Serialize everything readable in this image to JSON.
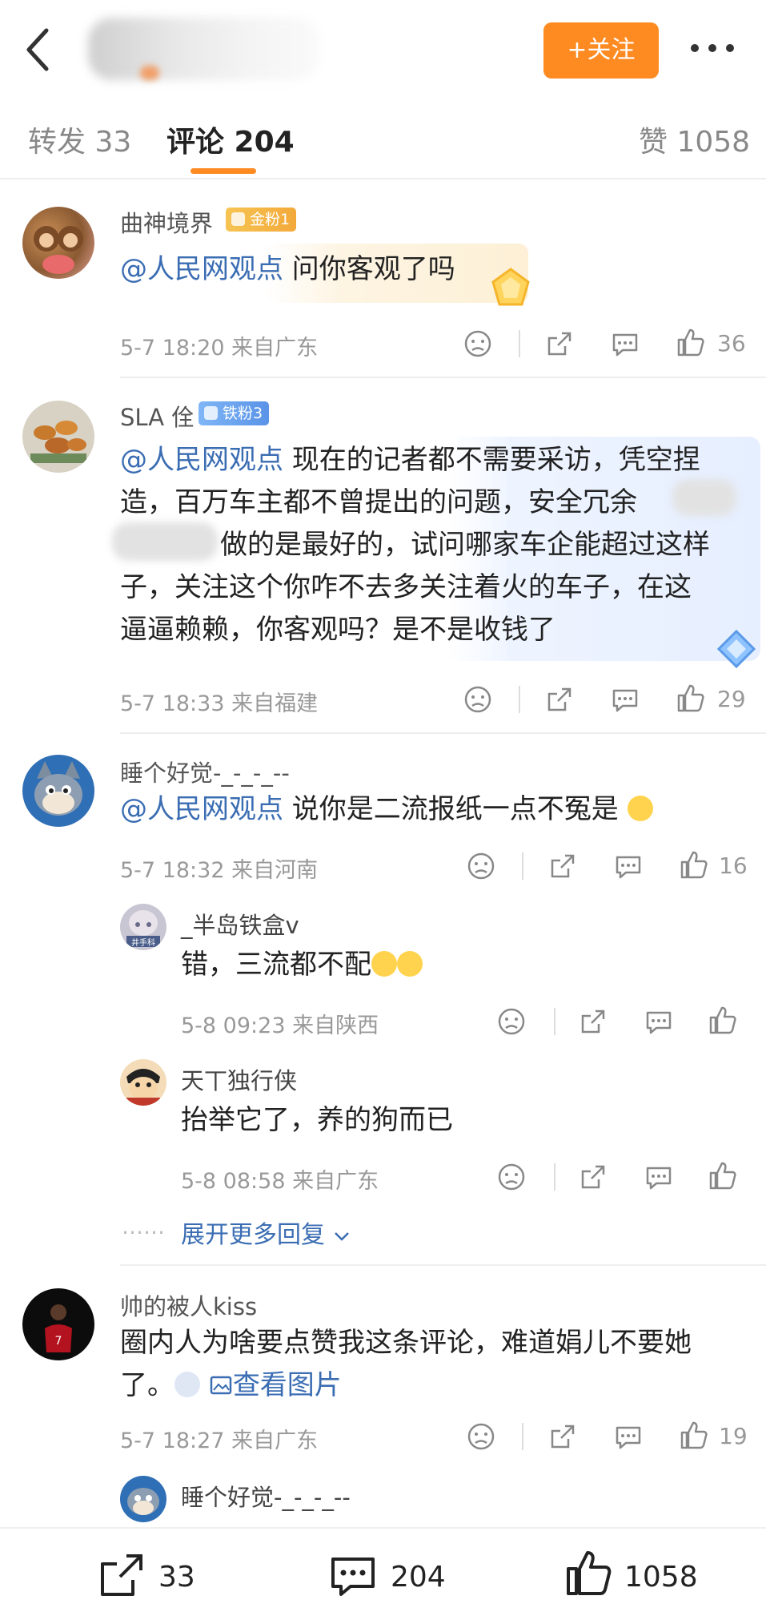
{
  "header": {
    "follow_label": "+关注"
  },
  "tabs": [
    {
      "label": "转发 33"
    },
    {
      "label": "评论 204"
    },
    {
      "label": "赞 1058"
    }
  ],
  "comments": [
    {
      "user": "曲神境界",
      "badge": "金粉1",
      "mention": "@人民网观点",
      "text": " 问你客观了吗",
      "meta": "5-7 18:20  来自广东",
      "likes": "36"
    },
    {
      "user": "SLA 佺",
      "badge": "铁粉3",
      "mention": "@人民网观点",
      "line1": " 现在的记者都不需要采访，凭空捏",
      "line2": "造，百万车主都不曾提出的问题，安全冗余",
      "line3": "做的是最好的，试问哪家车企能超过这样",
      "line4": "子，关注这个你咋不去多关注着火的车子，在这",
      "line5": "逼逼赖赖，你客观吗？是不是收钱了",
      "meta": "5-7 18:33  来自福建",
      "likes": "29"
    },
    {
      "user": "睡个好觉-_-_-_--",
      "mention": "@人民网观点",
      "text": "    说你是二流报纸一点不冤是",
      "meta": "5-7 18:32  来自河南",
      "likes": "16"
    },
    {
      "user": "帅的被人kiss",
      "line1": "圈内人为啥要点赞我这条评论，难道娟儿不要她",
      "line2": "了。",
      "image_link": "查看图片",
      "meta": "5-7 18:27  来自广东",
      "likes": "19"
    }
  ],
  "replies": [
    {
      "user": "_半岛铁盒v",
      "avatar_text": "井手科",
      "text": "错，三流都不配",
      "meta": "5-8 09:23  来自陕西"
    },
    {
      "user": "天丅独行侠",
      "text": "抬举它了，养的狗而已",
      "meta": "5-8 08:58  来自广东"
    },
    {
      "user": "睡个好觉-_-_-_--"
    }
  ],
  "expand_label": "展开更多回复",
  "expand_dots": "……",
  "bottom": {
    "repost_count": "33",
    "comment_count": "204",
    "like_count": "1058"
  },
  "colors": {
    "accent": "#fe8a22",
    "link": "#3b6db3"
  }
}
